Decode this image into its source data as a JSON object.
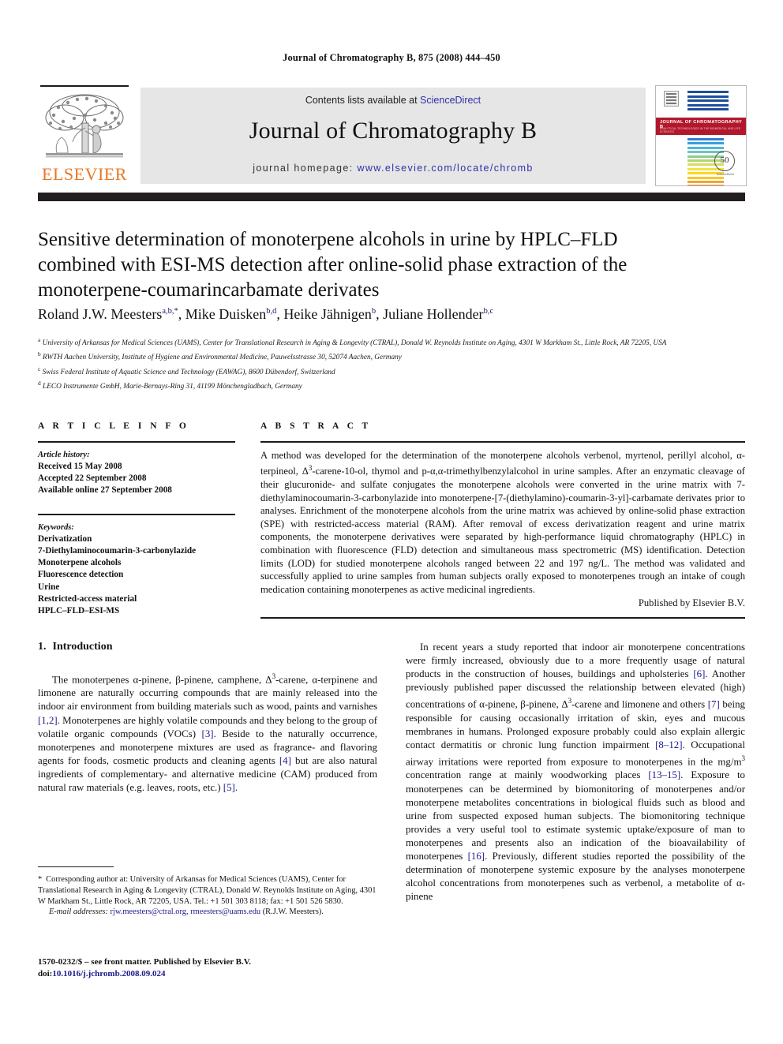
{
  "running_head": "Journal of Chromatography B, 875 (2008) 444–450",
  "banner": {
    "publisher_wordmark": "ELSEVIER",
    "contents_prefix": "Contents lists available at ",
    "contents_link": "ScienceDirect",
    "journal_title": "Journal of Chromatography B",
    "homepage_prefix": "journal homepage: ",
    "homepage_url": "www.elsevier.com/locate/chromb",
    "cover": {
      "band_title": "JOURNAL OF CHROMATOGRAPHY B",
      "band_subtitle": "ANALYTICAL TECHNOLOGIES IN THE BIOMEDICAL AND LIFE SCIENCES",
      "seal_number": "50",
      "seal_caption": "ScienceDirect"
    }
  },
  "article": {
    "title": "Sensitive determination of monoterpene alcohols in urine by HPLC–FLD combined with ESI-MS detection after online-solid phase extraction of the monoterpene-coumarincarbamate derivates",
    "authors": [
      {
        "name": "Roland J.W. Meesters",
        "marks": "a,b,*"
      },
      {
        "name": "Mike Duisken",
        "marks": "b,d"
      },
      {
        "name": "Heike Jähnigen",
        "marks": "b"
      },
      {
        "name": "Juliane Hollender",
        "marks": "b,c"
      }
    ],
    "affiliations": [
      {
        "mark": "a",
        "text": "University of Arkansas for Medical Sciences (UAMS), Center for Translational Research in Aging & Longevity (CTRAL), Donald W. Reynolds Institute on Aging, 4301 W Markham St., Little Rock, AR 72205, USA"
      },
      {
        "mark": "b",
        "text": "RWTH Aachen University, Institute of Hygiene and Environmental Medicine, Pauwelsstrasse 30, 52074 Aachen, Germany"
      },
      {
        "mark": "c",
        "text": "Swiss Federal Institute of Aquatic Science and Technology (EAWAG), 8600 Dübendorf, Switzerland"
      },
      {
        "mark": "d",
        "text": "LECO Instrumente GmbH, Marie-Bernays-Ring 31, 41199 Mönchengladbach, Germany"
      }
    ]
  },
  "article_info": {
    "heading": "A R T I C L E   I N F O",
    "history_label": "Article history:",
    "history": [
      "Received 15 May 2008",
      "Accepted 22 September 2008",
      "Available online 27 September 2008"
    ],
    "keywords_label": "Keywords:",
    "keywords": [
      "Derivatization",
      "7-Diethylaminocoumarin-3-carbonylazide",
      "Monoterpene alcohols",
      "Fluorescence detection",
      "Urine",
      "Restricted-access material",
      "HPLC–FLD–ESI-MS"
    ]
  },
  "abstract": {
    "heading": "A B S T R A C T",
    "body": "A method was developed for the determination of the monoterpene alcohols verbenol, myrtenol, perillyl alcohol, α-terpineol, Δ3-carene-10-ol, thymol and p-α,α-trimethylbenzylalcohol in urine samples. After an enzymatic cleavage of their glucuronide- and sulfate conjugates the monoterpene alcohols were converted in the urine matrix with 7-diethylaminocoumarin-3-carbonylazide into monoterpene-[7-(diethylamino)-coumarin-3-yl]-carbamate derivates prior to analyses. Enrichment of the monoterpene alcohols from the urine matrix was achieved by online-solid phase extraction (SPE) with restricted-access material (RAM). After removal of excess derivatization reagent and urine matrix components, the monoterpene derivatives were separated by high-performance liquid chromatography (HPLC) in combination with fluorescence (FLD) detection and simultaneous mass spectrometric (MS) identification. Detection limits (LOD) for studied monoterpene alcohols ranged between 22 and 197 ng/L. The method was validated and successfully applied to urine samples from human subjects orally exposed to monoterpenes trough an intake of cough medication containing monoterpenes as active medicinal ingredients.",
    "publisher_line": "Published by Elsevier B.V."
  },
  "introduction": {
    "number": "1.",
    "heading": "Introduction",
    "paragraph_left": "The monoterpenes α-pinene, β-pinene, camphene, Δ3-carene, α-terpinene and limonene are naturally occurring compounds that are mainly released into the indoor air environment from building materials such as wood, paints and varnishes [1,2]. Monoterpenes are highly volatile compounds and they belong to the group of volatile organic compounds (VOCs) [3]. Beside to the naturally occurrence, monoterpenes and monoterpene mixtures are used as fragrance- and flavoring agents for foods, cosmetic products and cleaning agents [4] but are also natural ingredients of complementary- and alternative medicine (CAM) produced from natural raw materials (e.g. leaves, roots, etc.) [5].",
    "paragraph_right": "In recent years a study reported that indoor air monoterpene concentrations were firmly increased, obviously due to a more frequently usage of natural products in the construction of houses, buildings and upholsteries [6]. Another previously published paper discussed the relationship between elevated (high) concentrations of α-pinene, β-pinene, Δ3-carene and limonene and others [7] being responsible for causing occasionally irritation of skin, eyes and mucous membranes in humans. Prolonged exposure probably could also explain allergic contact dermatitis or chronic lung function impairment [8–12]. Occupational airway irritations were reported from exposure to monoterpenes in the mg/m3 concentration range at mainly woodworking places [13–15]. Exposure to monoterpenes can be determined by biomonitoring of monoterpenes and/or monoterpene metabolites concentrations in biological fluids such as blood and urine from suspected exposed human subjects. The biomonitoring technique provides a very useful tool to estimate systemic uptake/exposure of man to monoterpenes and presents also an indication of the bioavailability of monoterpenes [16]. Previously, different studies reported the possibility of the determination of monoterpene systemic exposure by the analyses monoterpene alcohol concentrations from monoterpenes such as verbenol, a metabolite of α-pinene"
  },
  "footnote": {
    "star": "*",
    "corresponding": "Corresponding author at: University of Arkansas for Medical Sciences (UAMS), Center for Translational Research in Aging & Longevity (CTRAL), Donald W. Reynolds Institute on Aging, 4301 W Markham St., Little Rock, AR 72205, USA. Tel.: +1 501 303 8118; fax: +1 501 526 5830.",
    "email_label": "E-mail addresses:",
    "email_1": "rjw.meesters@ctral.org",
    "email_2": "rmeesters@uams.edu",
    "email_owner": "(R.J.W. Meesters)."
  },
  "colophon": {
    "front_matter": "1570-0232/$ – see front matter. Published by Elsevier B.V.",
    "doi_label": "doi:",
    "doi": "10.1016/j.jchromb.2008.09.024"
  },
  "colors": {
    "elsevier_orange": "#E87722",
    "link_blue": "#2f2fa8",
    "ref_blue": "#1a1a8c",
    "rule_dark": "#231f20",
    "panel_grey": "#e6e6e6",
    "cover_red": "#b2182b"
  }
}
